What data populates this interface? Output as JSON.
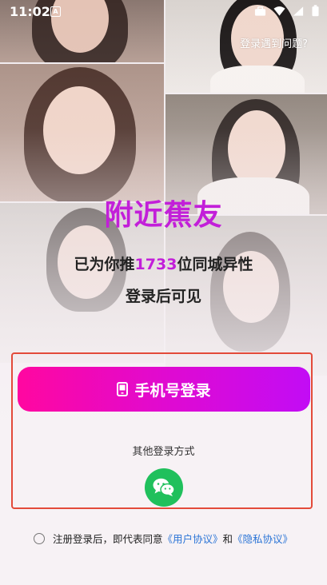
{
  "status_bar": {
    "time": "11:02",
    "notification_badge": "A",
    "icons": [
      "briefcase-icon",
      "wifi-icon",
      "signal-icon",
      "battery-icon"
    ]
  },
  "header": {
    "trouble_link": "登录遇到问题?"
  },
  "hero": {
    "title": "附近蕉友",
    "recommend_prefix": "已为你推",
    "recommend_count": "1733",
    "recommend_suffix": "位同城异性",
    "subtitle": "登录后可见"
  },
  "login": {
    "phone_button_label": "手机号登录",
    "other_methods_label": "其他登录方式",
    "wechat_icon": "wechat-icon"
  },
  "agreement": {
    "prefix": "注册登录后，即代表同意",
    "user_agreement": "《用户协议》",
    "conjunction": "和",
    "privacy_policy": "《隐私协议》"
  },
  "colors": {
    "accent_purple": "#c21fd9",
    "button_gradient_start": "#ff07a0",
    "button_gradient_end": "#c20cf5",
    "wechat_green": "#20c05c",
    "link_blue": "#2a74d6",
    "highlight_red": "#e34a3a"
  }
}
